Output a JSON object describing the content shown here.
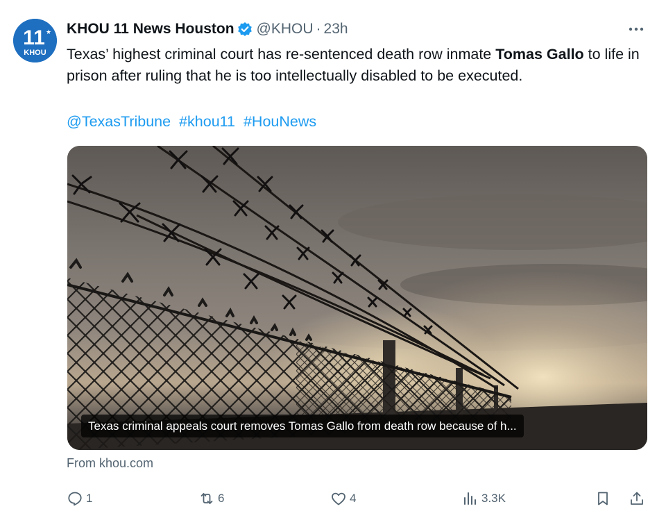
{
  "account": {
    "display_name": "KHOU 11 News Houston",
    "handle": "@KHOU",
    "separator": "·",
    "time_ago": "23h",
    "avatar_text_top": "11",
    "avatar_text_bottom": "KHOU",
    "verified_color": "#1d9bf0"
  },
  "tweet": {
    "text_part1": "Texas’ highest criminal court has re-sentenced death row inmate ",
    "text_bold": "Tomas Gallo",
    "text_part2": " to life in prison after ruling that he is too intellectually disabled to be executed.",
    "mention": "@TexasTribune",
    "hashtags": [
      "#khou11",
      "#HouNews"
    ]
  },
  "card": {
    "image_subject": "barbed-wire-fence-photo",
    "caption": "Texas criminal appeals court removes Tomas Gallo from death row because of h...",
    "source": "From khou.com"
  },
  "actions": {
    "replies": "1",
    "reposts": "6",
    "likes": "4",
    "views": "3.3K"
  },
  "colors": {
    "link": "#1d9bf0",
    "secondary_text": "#536471",
    "primary_text": "#0f1419"
  }
}
